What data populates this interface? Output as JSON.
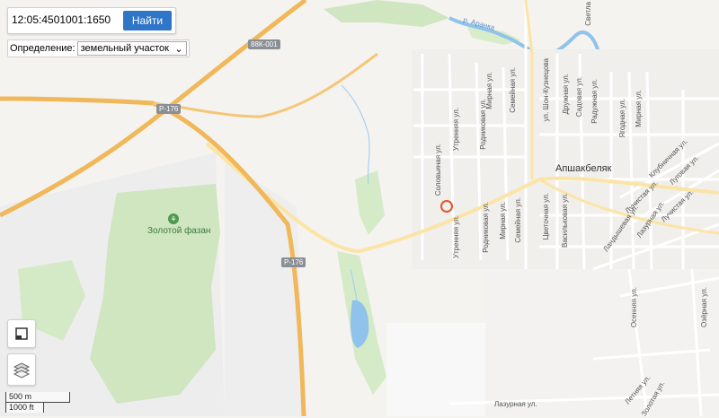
{
  "search": {
    "value": "12:05:4501001:1650",
    "button": "Найти"
  },
  "definition": {
    "label": "Определение:",
    "selected": "земельный участок"
  },
  "controls": {
    "fullscreen_icon": "fullscreen-icon",
    "layers_icon": "layers-icon"
  },
  "scale": {
    "metric": "500 m",
    "imperial": "1000 ft"
  },
  "roads": {
    "r176_a": "Р-176",
    "r176_b": "Р-176",
    "b88k": "88К-001"
  },
  "places": {
    "poi": "Золотой фазан",
    "town": "Апшакбеляк",
    "river": "р. Аранка"
  },
  "streets": {
    "utr1": "Утренняя ул.",
    "sol": "Соловьиная ул.",
    "rod1": "Родниковая ул.",
    "sem1": "Семейная ул.",
    "mir1": "Мирная ул.",
    "shon": "ул. Шон-Кузнецова",
    "dru": "Дружная ул.",
    "sad": "Садовая ул.",
    "rad": "Радужная ул.",
    "yag": "Ягодная ул.",
    "mir2": "Мирная ул.",
    "klub": "Клубничная ул.",
    "lug": "Луговая ул.",
    "utr2": "Утренняя ул.",
    "rod2": "Родниковая ул.",
    "mir3": "Мирная ул.",
    "sem2": "Семейная ул.",
    "svet": "Цветочная ул.",
    "vas": "Васильковая ул.",
    "lun1": "Лунистая ул.",
    "land": "Ландышевая ул.",
    "laz1": "Лазурная ул.",
    "lun2": "Лучистая ул.",
    "osen": "Осенняя ул.",
    "ozer": "Озёрная ул.",
    "let": "Летняя ул.",
    "laz2": "Лазурная ул.",
    "zol": "Золотая ул.",
    "sve": "Светла"
  },
  "colors": {
    "accent": "#2f76c8",
    "marker": "#e0562f",
    "highway": "#f7c46a"
  }
}
